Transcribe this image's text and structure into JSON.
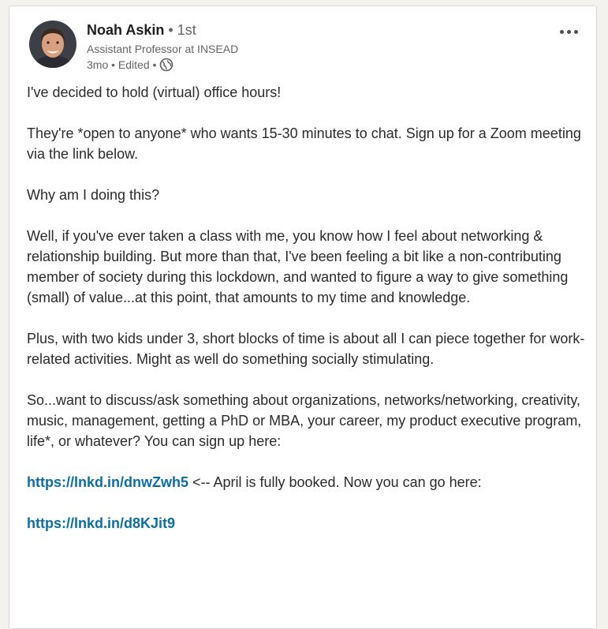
{
  "author": {
    "name": "Noah Askin",
    "degree": "• 1st",
    "headline": "Assistant Professor at INSEAD",
    "meta": "3mo • Edited •"
  },
  "post": {
    "p1": "I've decided to hold (virtual) office hours!",
    "p2": "They're *open to anyone* who wants 15-30 minutes to chat. Sign up for a Zoom meeting via the link below.",
    "p3": "Why am I doing this?",
    "p4": "Well, if you've ever taken a class with me, you know how I feel about networking & relationship building. But more than that, I've been feeling a bit like a non-contributing member of society during this lockdown, and wanted to figure a way to give something (small) of value...at this point, that amounts to my time and knowledge.",
    "p5": "Plus, with two kids under 3, short blocks of time is about all I can piece together for work-related activities. Might as well do something socially stimulating.",
    "p6": "So...want to discuss/ask something about organizations, networks/networking, creativity, music, management, getting a PhD or MBA, your career, my product executive program, life*, or whatever? You can sign up here:",
    "link1": "https://lnkd.in/dnwZwh5",
    "link1_note": " <-- April is fully booked. Now you can go here:",
    "link2": "https://lnkd.in/d8KJit9"
  }
}
